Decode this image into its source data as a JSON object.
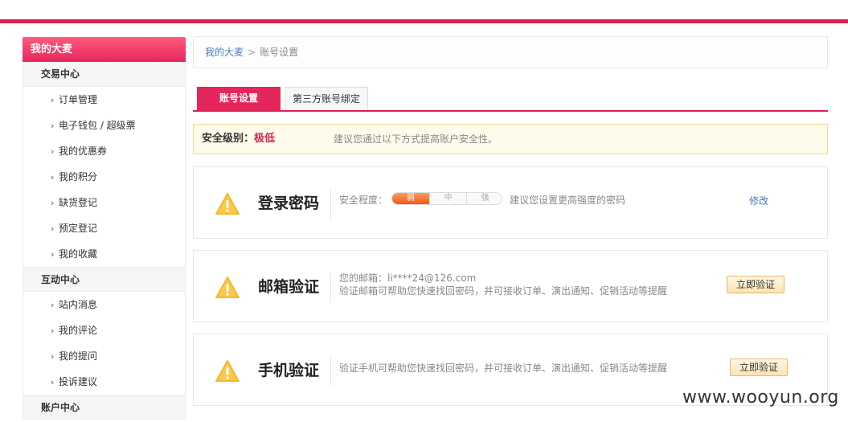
{
  "sidebar": {
    "header": "我的大麦",
    "sections": [
      {
        "title": "交易中心",
        "items": [
          "订单管理",
          "电子钱包 / 超级票",
          "我的优惠券",
          "我的积分",
          "缺货登记",
          "预定登记",
          "我的收藏"
        ]
      },
      {
        "title": "互动中心",
        "items": [
          "站内消息",
          "我的评论",
          "我的提问",
          "投诉建议"
        ]
      },
      {
        "title": "账户中心",
        "items": []
      }
    ]
  },
  "breadcrumb": {
    "home": "我的大麦",
    "separator": ">",
    "current": "账号设置"
  },
  "tabs": [
    {
      "label": "账号设置",
      "active": true
    },
    {
      "label": "第三方账号绑定",
      "active": false
    }
  ],
  "security_level": {
    "label": "安全级别：",
    "value": "极低",
    "tip": "建议您通过以下方式提高账户安全性。"
  },
  "cards": {
    "password": {
      "title": "登录密码",
      "strength_label": "安全程度：",
      "strength_levels": [
        "弱",
        "中",
        "强"
      ],
      "strength_current": "弱",
      "tip": "建议您设置更高强度的密码",
      "action": "修改"
    },
    "email": {
      "title": "邮箱验证",
      "line1": "您的邮箱：li****24@126.com",
      "line2": "验证邮箱可帮助您快速找回密码，并可接收订单、演出通知、促销活动等提醒",
      "action": "立即验证"
    },
    "phone": {
      "title": "手机验证",
      "line1": "验证手机可帮助您快速找回密码，并可接收订单、演出通知、促销活动等提醒",
      "action": "立即验证"
    }
  },
  "watermark": "www.wooyun.org",
  "colors": {
    "brand": "#d8224f",
    "warning": "#f0a81a",
    "link": "#4a7cb5"
  }
}
